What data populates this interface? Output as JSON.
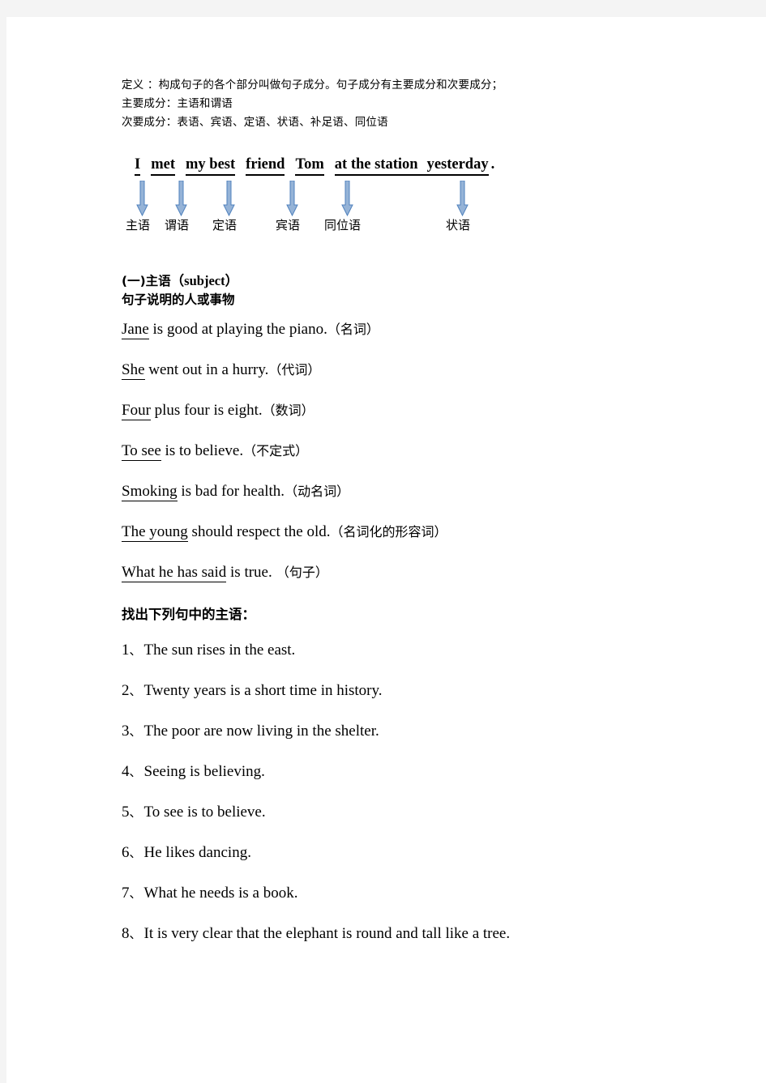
{
  "intro": {
    "lines": [
      "定义 ：构成句子的各个部分叫做句子成分。句子成分有主要成分和次要成分；",
      "主要成分：主语和谓语",
      "次要成分：表语、宾语、定语、状语、补足语、同位语"
    ]
  },
  "diagram": {
    "segments": [
      {
        "text": "I",
        "label": "主语"
      },
      {
        "text": "met",
        "label": "谓语"
      },
      {
        "text": "my best",
        "label": "定语"
      },
      {
        "text": "friend",
        "label": "宾语"
      },
      {
        "text": "Tom",
        "label": "同位语"
      },
      {
        "text": "at the station",
        "label": "状语"
      },
      {
        "text": "yesterday",
        "label": ""
      }
    ],
    "period": ".",
    "arrow_color": "#95B3D7",
    "arrow_outline": "#4F81BD"
  },
  "section": {
    "number_title": "(一)主语",
    "english": "（subject）",
    "subtitle": "句子说明的人或事物"
  },
  "examples": [
    {
      "subject": "Jane",
      "rest": " is good at playing the piano.",
      "pos": "（名词）"
    },
    {
      "subject": "She",
      "rest": " went out in a hurry.",
      "pos": "（代词）"
    },
    {
      "subject": "Four",
      "rest": " plus four is eight.",
      "pos": "（数词）"
    },
    {
      "subject": "To see",
      "rest": " is to believe.",
      "pos": "（不定式）"
    },
    {
      "subject": "Smoking",
      "rest": " is bad for health.",
      "pos": "（动名词）"
    },
    {
      "subject": "The young",
      "rest": " should respect the old.",
      "pos": "（名词化的形容词）"
    },
    {
      "subject": "What he has said",
      "rest": " is true.",
      "pos": " （句子）"
    }
  ],
  "exercise": {
    "heading": "找出下列句中的主语：",
    "separator": "、",
    "items": [
      {
        "num": "1",
        "text": "The sun rises in the east."
      },
      {
        "num": "2",
        "text": "Twenty years is a short time in history."
      },
      {
        "num": "3",
        "text": "The poor are now living in the shelter."
      },
      {
        "num": "4",
        "text": "Seeing is believing."
      },
      {
        "num": "5",
        "text": "To see is to believe."
      },
      {
        "num": "6",
        "text": "He likes dancing."
      },
      {
        "num": "7",
        "text": "What he needs is a book."
      },
      {
        "num": "8",
        "text": "It is very clear that the elephant is round and tall like a tree."
      }
    ]
  }
}
